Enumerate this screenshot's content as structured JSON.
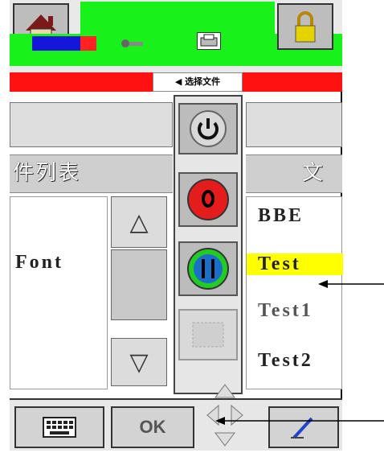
{
  "title_tab": {
    "label": "选择文件",
    "arrow": "◀"
  },
  "left_panel": {
    "header": "件列表",
    "items": [
      "Font"
    ]
  },
  "right_panel": {
    "header": "文",
    "items": [
      "BBE",
      "Test",
      "Test1",
      "Test2"
    ]
  },
  "scroll": {
    "up": "△",
    "down": "▽"
  },
  "bottom": {
    "ok_label": "OK"
  },
  "colors": {
    "accent_green": "#19f21a",
    "alert_red": "#f11",
    "highlight_yellow": "#ffff00"
  }
}
